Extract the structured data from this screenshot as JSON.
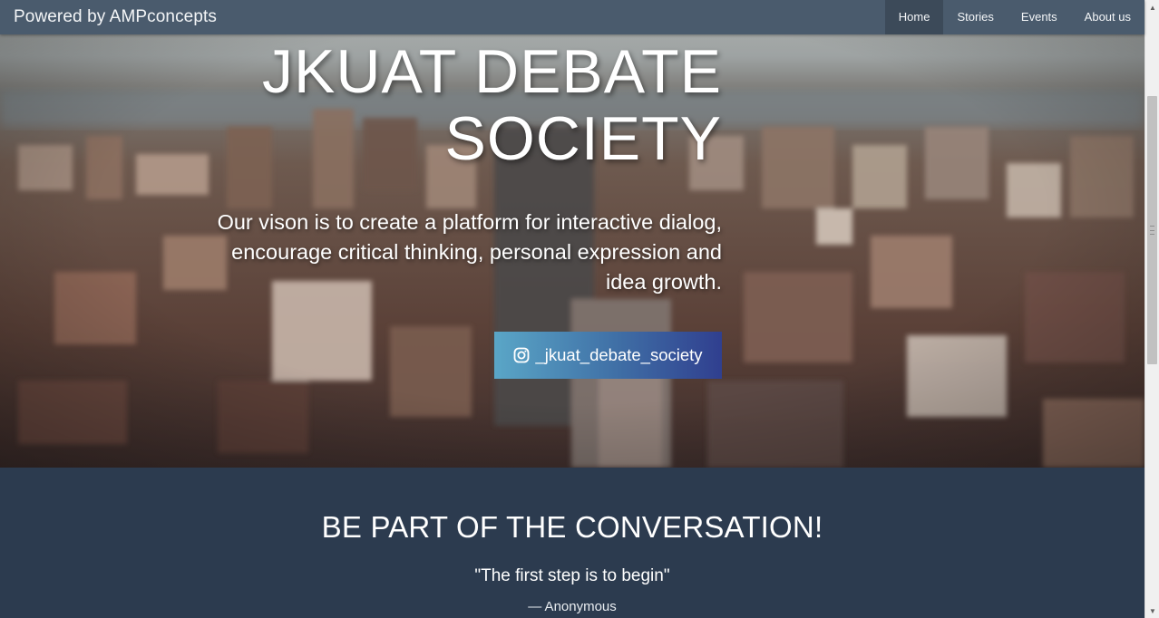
{
  "navbar": {
    "brand": "Powered by AMPconcepts",
    "items": [
      {
        "label": "Home",
        "active": true
      },
      {
        "label": "Stories",
        "active": false
      },
      {
        "label": "Events",
        "active": false
      },
      {
        "label": "About us",
        "active": false
      }
    ]
  },
  "hero": {
    "title_line1": "JKUAT DEBATE",
    "title_line2": "SOCIETY",
    "vision_line1": "Our vison is to create a platform for interactive dialog,",
    "vision_line2": "encourage critical thinking, personal expression and",
    "vision_line3": "idea growth.",
    "instagram_button": {
      "icon": "instagram-icon",
      "label": "_jkuat_debate_society"
    }
  },
  "section": {
    "heading": "BE PART OF THE CONVERSATION!",
    "quote": "\"The first step is to begin\"",
    "author": "— Anonymous"
  },
  "colors": {
    "navbar_bg": "#4a5b6d",
    "nav_active_bg": "#3c4a59",
    "section_bg": "#2c3b4f",
    "button_gradient_start": "#5aa6c7",
    "button_gradient_end": "#303f8f"
  }
}
